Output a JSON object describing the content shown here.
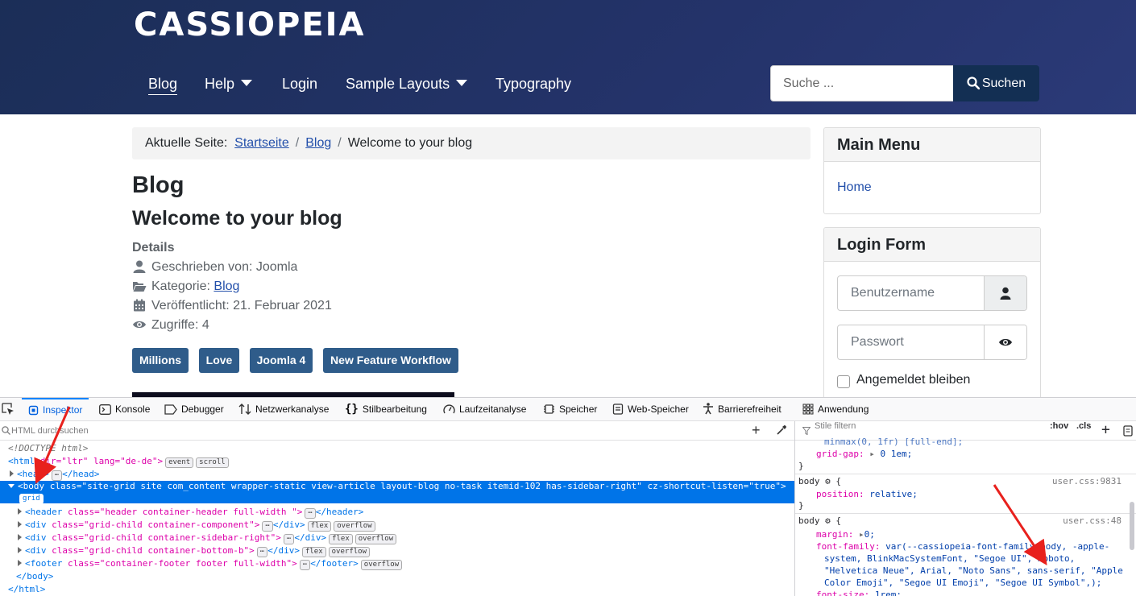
{
  "site": {
    "brand": "CASSIOPEIA",
    "nav": [
      {
        "label": "Blog"
      },
      {
        "label": "Help"
      },
      {
        "label": "Login"
      },
      {
        "label": "Sample Layouts"
      },
      {
        "label": "Typography"
      }
    ],
    "search": {
      "placeholder": "Suche ...",
      "button": "Suchen"
    }
  },
  "breadcrumb": {
    "prefix": "Aktuelle Seite:",
    "items": [
      "Startseite",
      "Blog",
      "Welcome to your blog"
    ],
    "separator": "/"
  },
  "article": {
    "page_title": "Blog",
    "title": "Welcome to your blog",
    "details_label": "Details",
    "author": "Geschrieben von: Joomla",
    "category_label": "Kategorie:",
    "category": "Blog",
    "published": "Veröffentlicht: 21. Februar 2021",
    "hits": "Zugriffe: 4",
    "tags": [
      "Millions",
      "Love",
      "Joomla 4",
      "New Feature Workflow"
    ]
  },
  "sidebar": {
    "main_menu": {
      "title": "Main Menu",
      "items": [
        "Home"
      ]
    },
    "login": {
      "title": "Login Form",
      "username_placeholder": "Benutzername",
      "password_placeholder": "Passwort",
      "remember": "Angemeldet bleiben"
    }
  },
  "devtools": {
    "tabs": [
      "Inspektor",
      "Konsole",
      "Debugger",
      "Netzwerkanalyse",
      "Stilbearbeitung",
      "Laufzeitanalyse",
      "Speicher",
      "Web-Speicher",
      "Barrierefreiheit",
      "Anwendung"
    ],
    "html_search_placeholder": "HTML durchsuchen",
    "styles_filter_placeholder": "Stile filtern",
    "hov": ":hov",
    "cls": ".cls",
    "markup": {
      "doctype": "<!DOCTYPE html>",
      "html_open": "<html",
      "html_attrs": " dir=\"ltr\" lang=\"de-de\">",
      "event_badge": "event",
      "scroll_badge": "scroll",
      "head_line": "<head>",
      "head_close": "</head>",
      "body_open": "<body",
      "body_attrs": " class=\"site-grid site com_content wrapper-static view-article layout-blog no-task itemid-102 has-sidebar-right\" cz-shortcut-listen=\"true\">",
      "grid_badge": "grid",
      "children": [
        {
          "open": "<header",
          "attrs": " class=\"header container-header full-width \">",
          "close": "</header>",
          "badges": []
        },
        {
          "open": "<div",
          "attrs": " class=\"grid-child container-component\">",
          "close": "</div>",
          "badges": [
            "flex",
            "overflow"
          ]
        },
        {
          "open": "<div",
          "attrs": " class=\"grid-child container-sidebar-right\">",
          "close": "</div>",
          "badges": [
            "flex",
            "overflow"
          ]
        },
        {
          "open": "<div",
          "attrs": " class=\"grid-child container-bottom-b\">",
          "close": "</div>",
          "badges": [
            "flex",
            "overflow"
          ]
        },
        {
          "open": "<footer",
          "attrs": " class=\"container-footer footer full-width\">",
          "close": "</footer>",
          "badges": [
            "overflow"
          ]
        }
      ],
      "ellipsis": "⋯",
      "body_close": "</body>",
      "html_close": "</html>"
    },
    "rules": {
      "partial_top": "minmax(0, 1fr) [full-end];",
      "grid_gap_prop": "grid-gap:",
      "grid_gap_value": "0 1em;",
      "close_brace": "}",
      "rule1_selector": "body",
      "rule1_source": "user.css:9831",
      "rule1_prop": "position:",
      "rule1_value": "relative;",
      "rule2_selector": "body",
      "rule2_source": "user.css:48",
      "margin_prop": "margin:",
      "margin_value": "0;",
      "font_family_prop": "font-family:",
      "font_family_line1": "var(--cassiopeia-font-family-body, -apple-",
      "font_family_line2": "system, BlinkMacSystemFont, \"Segoe UI\", Roboto,",
      "font_family_line3": "\"Helvetica Neue\", Arial, \"Noto Sans\", sans-serif, \"Apple",
      "font_family_line4": "Color Emoji\", \"Segoe UI Emoji\", \"Segoe UI Symbol\",);",
      "font_size_prop": "font-size:",
      "font_size_value": "1rem;",
      "open_brace": "{"
    }
  },
  "colors": {
    "header_bg": "#1b2e57",
    "search_button": "#132f53",
    "tag_bg": "#2f5c8a",
    "link": "#224faa",
    "devtools_selection": "#0074e8",
    "annotation_arrow": "#e8211d"
  }
}
